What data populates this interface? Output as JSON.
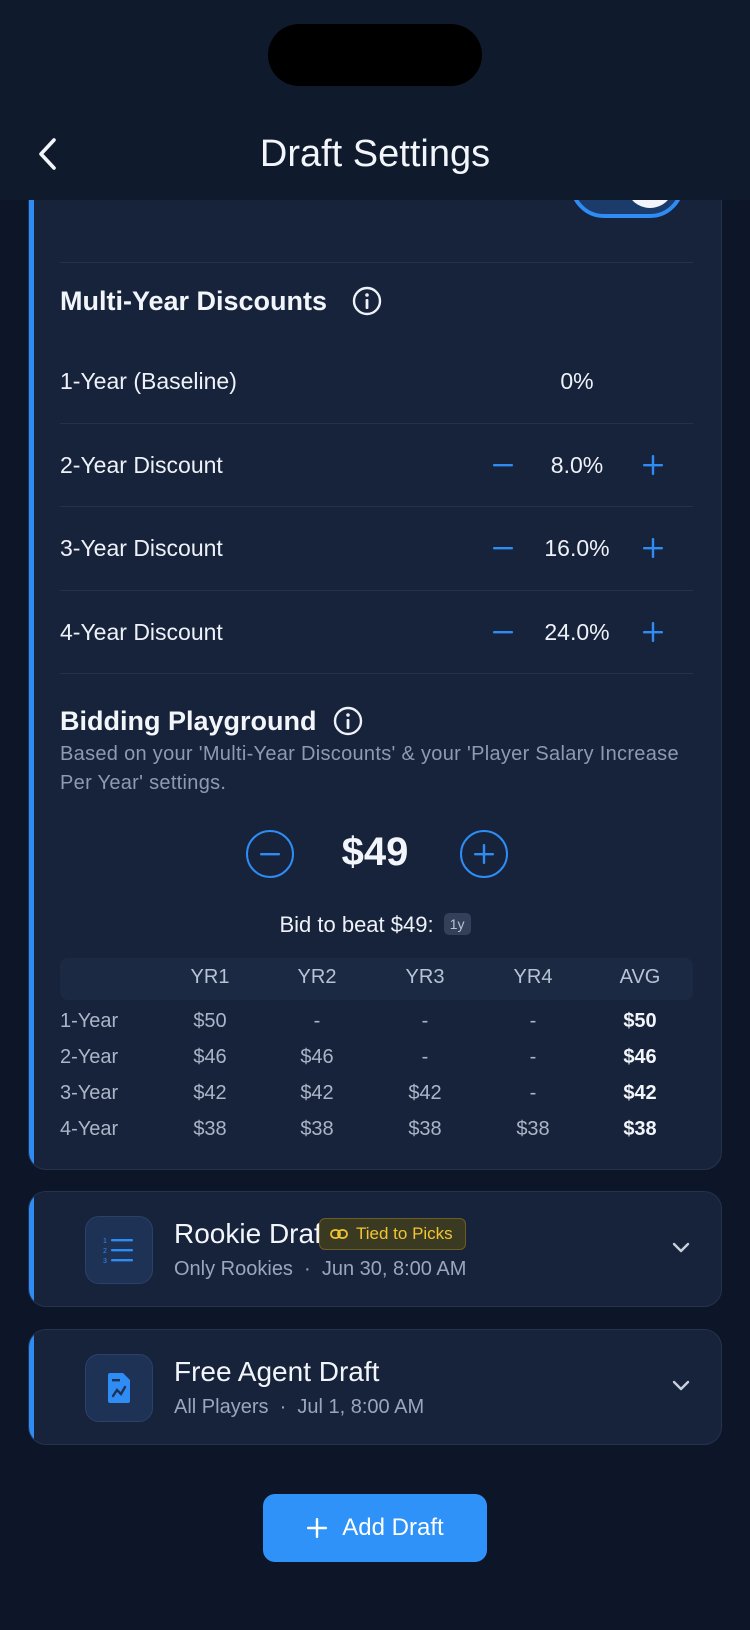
{
  "header": {
    "title": "Draft Settings",
    "back_icon": "chevron-left-icon"
  },
  "discounts": {
    "title": "Multi-Year Discounts",
    "rows": [
      {
        "label": "1-Year (Baseline)",
        "value": "0%",
        "adjustable": false
      },
      {
        "label": "2-Year Discount",
        "value": "8.0%",
        "adjustable": true
      },
      {
        "label": "3-Year Discount",
        "value": "16.0%",
        "adjustable": true
      },
      {
        "label": "4-Year Discount",
        "value": "24.0%",
        "adjustable": true
      }
    ]
  },
  "playground": {
    "title": "Bidding Playground",
    "description": "Based on your 'Multi-Year Discounts' & your 'Player Salary Increase Per Year' settings.",
    "bid": "$49",
    "beat_label": "Bid to beat $49:",
    "beat_badge": "1y",
    "table": {
      "headers": [
        "",
        "YR1",
        "YR2",
        "YR3",
        "YR4",
        "AVG"
      ],
      "rows": [
        [
          "1-Year",
          "$50",
          "-",
          "-",
          "-",
          "$50"
        ],
        [
          "2-Year",
          "$46",
          "$46",
          "-",
          "-",
          "$46"
        ],
        [
          "3-Year",
          "$42",
          "$42",
          "$42",
          "-",
          "$42"
        ],
        [
          "4-Year",
          "$38",
          "$38",
          "$38",
          "$38",
          "$38"
        ]
      ]
    }
  },
  "drafts": [
    {
      "title": "Rookie Draft",
      "badge": "Tied to Picks",
      "type": "Only Rookies",
      "date": "Jun 30, 8:00 AM",
      "icon": "numbered-list-icon"
    },
    {
      "title": "Free Agent Draft",
      "badge": "",
      "type": "All Players",
      "date": "Jul 1, 8:00 AM",
      "icon": "document-chart-icon"
    }
  ],
  "add_button": {
    "label": "Add Draft"
  },
  "colors": {
    "accent": "#2f8cf5",
    "background": "#0d1628",
    "card": "#17233b",
    "badge_text": "#f2c531"
  }
}
